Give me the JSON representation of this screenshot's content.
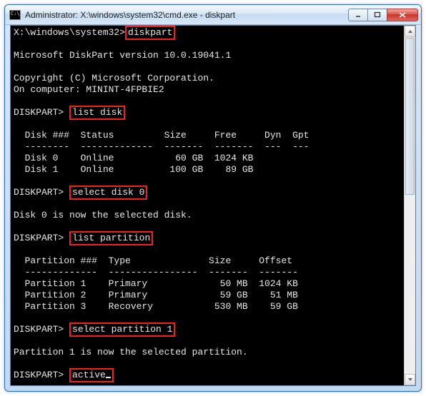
{
  "window": {
    "title": "Administrator: X:\\windows\\system32\\cmd.exe - diskpart"
  },
  "prompt_path": "X:\\windows\\system32>",
  "cmd_diskpart": "diskpart",
  "version_line": "Microsoft DiskPart version 10.0.19041.1",
  "copyright_line": "Copyright (C) Microsoft Corporation.",
  "computer_line": "On computer: MININT-4FPBIE2",
  "dp_prompt": "DISKPART>",
  "cmd_list_disk": "list disk",
  "disk_table": {
    "header": "  Disk ###  Status         Size     Free     Dyn  Gpt",
    "divider": "  --------  -------------  -------  -------  ---  ---",
    "rows": [
      "  Disk 0    Online           60 GB  1024 KB",
      "  Disk 1    Online          100 GB    89 GB"
    ]
  },
  "cmd_select_disk": "select disk 0",
  "msg_disk_selected": "Disk 0 is now the selected disk.",
  "cmd_list_partition": "list partition",
  "part_table": {
    "header": "  Partition ###  Type              Size     Offset",
    "divider": "  -------------  ----------------  -------  -------",
    "rows": [
      "  Partition 1    Primary             50 MB  1024 KB",
      "  Partition 2    Primary             59 GB    51 MB",
      "  Partition 3    Recovery           530 MB    59 GB"
    ]
  },
  "cmd_select_partition": "select partition 1",
  "msg_part_selected": "Partition 1 is now the selected partition.",
  "cmd_active": "active"
}
